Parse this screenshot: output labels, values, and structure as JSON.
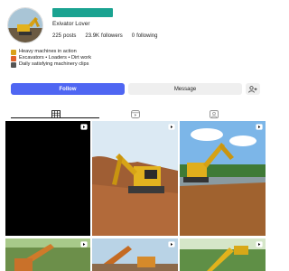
{
  "profile": {
    "display_name": "Exivator Lover",
    "posts_count": "225",
    "posts_label": "posts",
    "followers_count": "23.9K",
    "followers_label": "followers",
    "following_count": "0",
    "following_label": "following"
  },
  "bio": [
    {
      "icon": "excavator-emoji-icon",
      "text": "Heavy machines in action"
    },
    {
      "icon": "construction-emoji-icon",
      "text": "Excavators • Loaders • Dirt work"
    },
    {
      "icon": "video-camera-emoji-icon",
      "text": "Daily satisfying machinery clips"
    }
  ],
  "actions": {
    "follow_label": "Follow",
    "message_label": "Message"
  },
  "tabs": [
    {
      "icon": "grid-icon",
      "active": true
    },
    {
      "icon": "reels-icon",
      "active": false
    },
    {
      "icon": "tagged-icon",
      "active": false
    }
  ],
  "colors": {
    "username_bar": "#1aa391",
    "follow_button": "#4f66f2",
    "tab_active": "#111111",
    "tab_inactive": "#8e8e8e",
    "reel_badge": "#ffffff"
  },
  "grid_posts": [
    {
      "kind": "reel",
      "scene": "black-screen"
    },
    {
      "kind": "reel",
      "scene": "yellow-excavator-on-dirt-slope"
    },
    {
      "kind": "reel",
      "scene": "yellow-excavator-by-pond"
    },
    {
      "kind": "reel",
      "scene": "excavator-among-trees"
    },
    {
      "kind": "reel",
      "scene": "excavator-under-sky"
    },
    {
      "kind": "reel",
      "scene": "yellow-excavator-arm-in-trees"
    }
  ]
}
